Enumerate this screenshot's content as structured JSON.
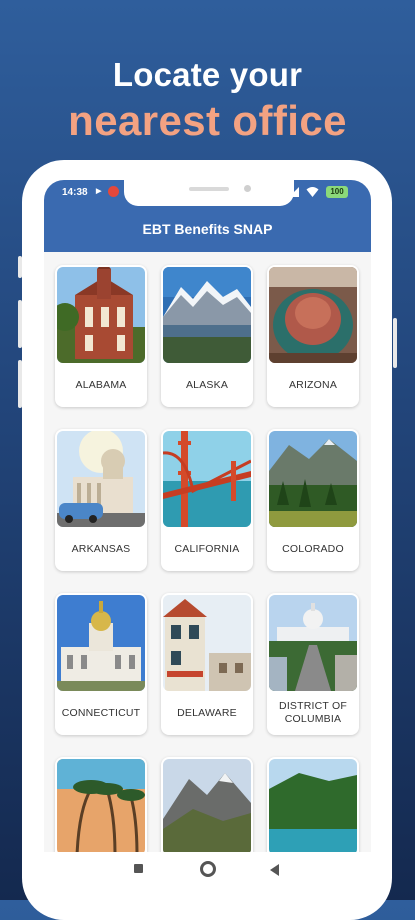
{
  "promo": {
    "line1": "Locate your",
    "line2": "nearest office"
  },
  "status_bar": {
    "time": "14:38",
    "battery": "100"
  },
  "app": {
    "title": "EBT Benefits SNAP"
  },
  "states": [
    {
      "label": "ALABAMA"
    },
    {
      "label": "ALASKA"
    },
    {
      "label": "ARIZONA"
    },
    {
      "label": "ARKANSAS"
    },
    {
      "label": "CALIFORNIA"
    },
    {
      "label": "COLORADO"
    },
    {
      "label": "CONNECTICUT"
    },
    {
      "label": "DELAWARE"
    },
    {
      "label": "DISTRICT OF COLUMBIA"
    }
  ],
  "colors": {
    "accent": "#3a6ab0",
    "fab": "#f26b2a",
    "headline_highlight": "#f3a282"
  },
  "icons": {
    "fab": "arrow-left-icon",
    "nav_recents": "square-icon",
    "nav_home": "circle-icon",
    "nav_back": "triangle-back-icon"
  }
}
